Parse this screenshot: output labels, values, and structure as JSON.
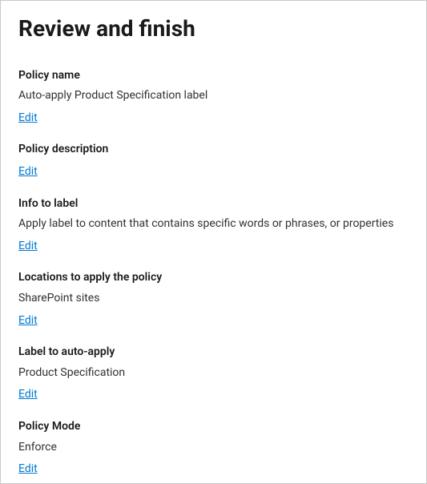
{
  "title": "Review and finish",
  "edit_label": "Edit",
  "sections": {
    "policy_name": {
      "label": "Policy name",
      "value": "Auto-apply Product Specification label"
    },
    "policy_description": {
      "label": "Policy description",
      "value": ""
    },
    "info_to_label": {
      "label": "Info to label",
      "value": "Apply label to content that contains specific words or phrases, or properties"
    },
    "locations": {
      "label": "Locations to apply the policy",
      "value": "SharePoint sites"
    },
    "label_to_apply": {
      "label": "Label to auto-apply",
      "value": "Product Specification"
    },
    "policy_mode": {
      "label": "Policy Mode",
      "value": "Enforce"
    }
  }
}
